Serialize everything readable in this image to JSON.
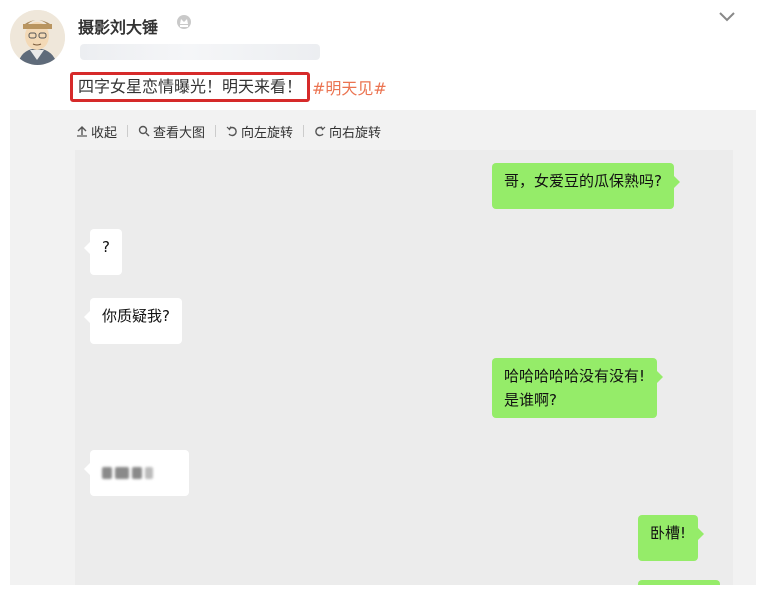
{
  "post": {
    "username": "摄影刘大锤",
    "text": "四字女星恋情曝光！明天来看！",
    "hashtag": "#明天见#"
  },
  "toolbar": {
    "collapse_label": "收起",
    "view_large_label": "查看大图",
    "rotate_left_label": "向左旋转",
    "rotate_right_label": "向右旋转"
  },
  "chat": {
    "messages": [
      {
        "side": "right",
        "text": "哥，女爱豆的瓜保熟吗?"
      },
      {
        "side": "left",
        "text": "?"
      },
      {
        "side": "left",
        "text": "你质疑我?"
      },
      {
        "side": "right",
        "text": "哈哈哈哈哈没有没有!",
        "text2": "是谁啊?"
      },
      {
        "side": "left",
        "text": ""
      },
      {
        "side": "right",
        "text": "卧槽!"
      },
      {
        "side": "right",
        "text": ""
      }
    ]
  },
  "colors": {
    "bubble_me": "#95ec69",
    "bubble_them": "#ffffff",
    "hashtag": "#eb7350",
    "highlight_border": "#d62a2a",
    "chat_bg": "#ececec"
  },
  "icons": [
    "vip-icon",
    "chevron-down-icon",
    "collapse-arrow-icon",
    "search-icon",
    "rotate-left-icon",
    "rotate-right-icon"
  ]
}
